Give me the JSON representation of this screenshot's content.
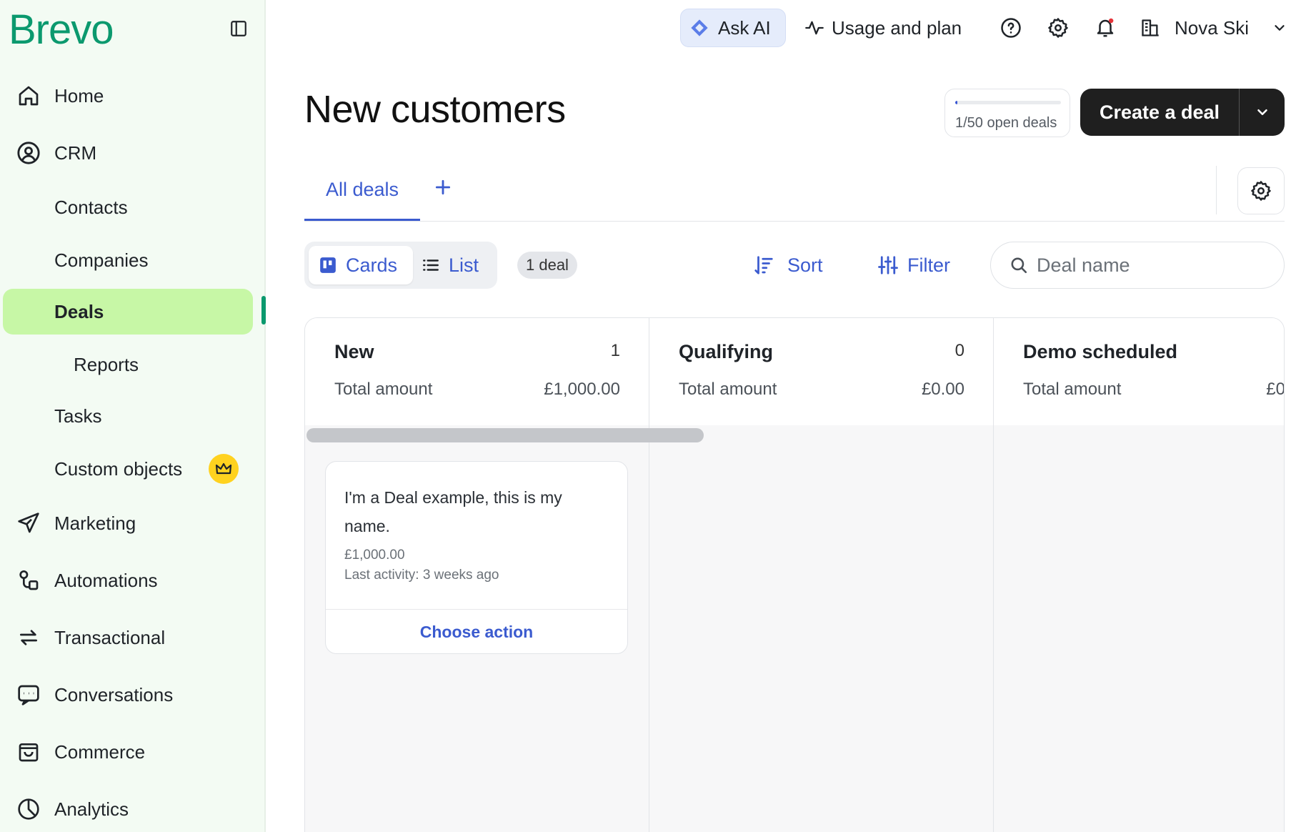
{
  "brand": {
    "logo": "Brevo",
    "color": "#0b996e"
  },
  "sidebar": {
    "items": [
      {
        "label": "Home",
        "icon": "home-icon"
      },
      {
        "label": "CRM",
        "icon": "crm-icon"
      },
      {
        "label": "Contacts"
      },
      {
        "label": "Companies"
      },
      {
        "label": "Deals",
        "active": true
      },
      {
        "label": "Reports"
      },
      {
        "label": "Tasks"
      },
      {
        "label": "Custom objects",
        "badge": "crown-icon"
      },
      {
        "label": "Marketing",
        "icon": "send-icon"
      },
      {
        "label": "Automations",
        "icon": "automation-icon"
      },
      {
        "label": "Transactional",
        "icon": "transfer-icon"
      },
      {
        "label": "Conversations",
        "icon": "chat-icon"
      },
      {
        "label": "Commerce",
        "icon": "bag-icon"
      },
      {
        "label": "Analytics",
        "icon": "pie-chart-icon"
      }
    ]
  },
  "topbar": {
    "ask_ai": "Ask AI",
    "usage": "Usage and plan",
    "account": "Nova Ski"
  },
  "header": {
    "title": "New customers",
    "open_deals": {
      "text": "1/50 open deals",
      "progress": 0.02
    },
    "create_deal": "Create a deal"
  },
  "tabs": {
    "all_deals": "All deals"
  },
  "toolbar": {
    "cards": "Cards",
    "list": "List",
    "deal_count": "1 deal",
    "sort": "Sort",
    "filter": "Filter",
    "search_placeholder": "Deal name"
  },
  "columns": [
    {
      "name": "New",
      "count": "1",
      "total_label": "Total amount",
      "total": "£1,000.00"
    },
    {
      "name": "Qualifying",
      "count": "0",
      "total_label": "Total amount",
      "total": "£0.00"
    },
    {
      "name": "Demo scheduled",
      "count": "",
      "total_label": "Total amount",
      "total": "£0"
    }
  ],
  "deal": {
    "name": "I'm a Deal example, this is my name.",
    "amount": "£1,000.00",
    "activity": "Last activity: 3 weeks ago",
    "action": "Choose action"
  },
  "colors": {
    "accent": "#3b5bcf",
    "active_nav": "#c7f7a6",
    "button_dark": "#1f1f1f"
  }
}
